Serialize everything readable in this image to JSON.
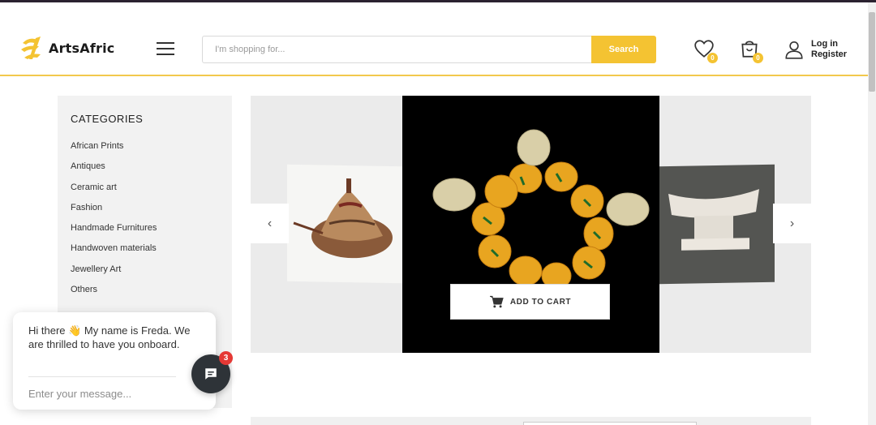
{
  "brand": {
    "name": "ArtsAfric",
    "accent": "#f4c332"
  },
  "header": {
    "menu_icon": "hamburger-icon",
    "search": {
      "placeholder": "I'm shopping for...",
      "value": "",
      "button_label": "Search"
    },
    "wishlist": {
      "icon": "heart-icon",
      "count": "0"
    },
    "cart": {
      "icon": "shopping-bag-icon",
      "count": "0"
    },
    "account": {
      "icon": "user-icon",
      "login_label": "Log in",
      "register_label": "Register"
    }
  },
  "sidebar": {
    "title": "CATEGORIES",
    "items": [
      {
        "label": "African Prints"
      },
      {
        "label": "Antiques"
      },
      {
        "label": "Ceramic art"
      },
      {
        "label": "Fashion"
      },
      {
        "label": "Handmade Furnitures"
      },
      {
        "label": "Handwoven materials"
      },
      {
        "label": "Jewellery Art"
      },
      {
        "label": "Others"
      }
    ]
  },
  "carousel": {
    "prev_icon": "chevron-left-icon",
    "next_icon": "chevron-right-icon",
    "prev_glyph": "‹",
    "next_glyph": "›",
    "add_to_cart_label": "ADD TO CART",
    "cart_icon": "cart-icon"
  },
  "chat": {
    "message": "Hi there 👋 My name is Freda. We are thrilled to have you onboard.",
    "input_placeholder": "Enter your message...",
    "unread_count": "3",
    "launcher_icon": "chat-bubble-icon"
  }
}
